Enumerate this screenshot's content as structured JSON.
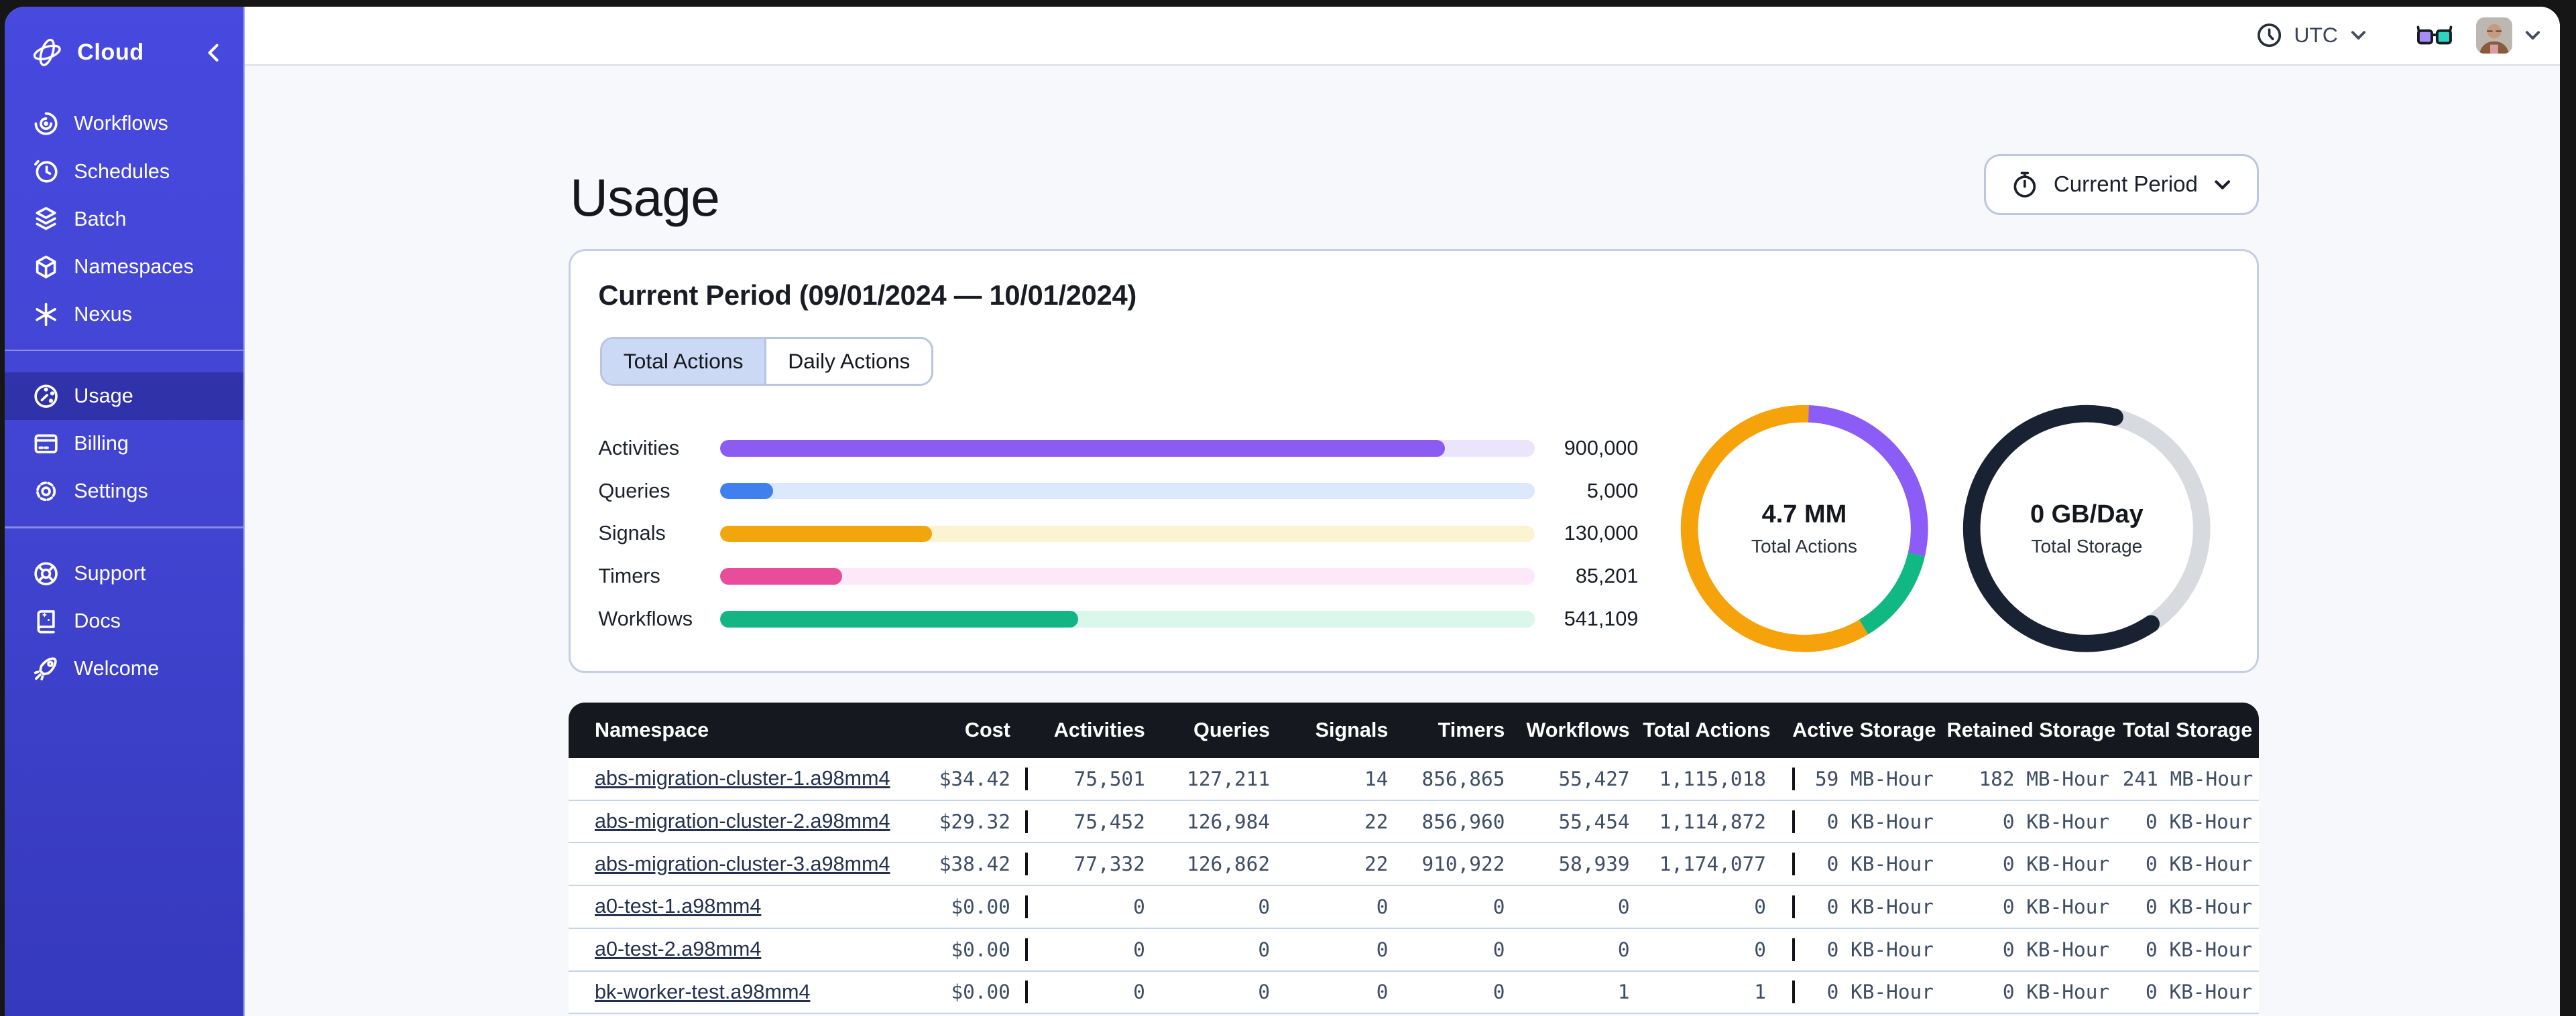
{
  "topbar": {
    "timezone": "UTC"
  },
  "sidebar": {
    "brand": "Cloud",
    "groups": [
      [
        {
          "icon": "workflows-icon",
          "label": "Workflows"
        },
        {
          "icon": "schedules-icon",
          "label": "Schedules"
        },
        {
          "icon": "batch-icon",
          "label": "Batch"
        },
        {
          "icon": "namespaces-icon",
          "label": "Namespaces"
        },
        {
          "icon": "nexus-icon",
          "label": "Nexus"
        }
      ],
      [
        {
          "icon": "usage-icon",
          "label": "Usage",
          "active": true
        },
        {
          "icon": "billing-icon",
          "label": "Billing"
        },
        {
          "icon": "settings-icon",
          "label": "Settings"
        }
      ],
      [
        {
          "icon": "support-icon",
          "label": "Support"
        },
        {
          "icon": "docs-icon",
          "label": "Docs"
        },
        {
          "icon": "welcome-icon",
          "label": "Welcome"
        }
      ]
    ]
  },
  "page": {
    "title": "Usage",
    "period_selector_label": "Current Period"
  },
  "usage_card": {
    "title": "Current Period (09/01/2024 — 10/01/2024)",
    "tabs": [
      {
        "label": "Total Actions",
        "active": true
      },
      {
        "label": "Daily Actions",
        "active": false
      }
    ]
  },
  "colors": {
    "sidebar_indigo": "#4548dc",
    "sidebar_active": "#383cb4",
    "table_header_black": "#15181f",
    "accent_border": "#b7c4e2"
  },
  "chart_data": [
    {
      "type": "bar",
      "orientation": "horizontal",
      "categories": [
        "Activities",
        "Queries",
        "Signals",
        "Timers",
        "Workflows"
      ],
      "values": [
        900000,
        5000,
        130000,
        85201,
        541109
      ],
      "value_labels": [
        "900,000",
        "5,000",
        "130,000",
        "85,201",
        "541,109"
      ],
      "fill_pcts": [
        89,
        6.5,
        26,
        15,
        44
      ],
      "colors": [
        "#8c5cf2",
        "#4080ee",
        "#f2a60d",
        "#e84d9c",
        "#13b585"
      ],
      "track_colors": [
        "#ebe5fb",
        "#dce8fb",
        "#fcf3d1",
        "#fce8f8",
        "#d9f7ea"
      ],
      "title": "",
      "xlabel": "",
      "ylabel": "",
      "grid": false,
      "legend": false
    },
    {
      "type": "donut",
      "name": "total-actions-donut",
      "center_value": "4.7 MM",
      "center_label": "Total Actions",
      "segments": [
        {
          "name": "activities",
          "color": "#8b5cf6",
          "start_deg": 2,
          "sweep_deg": 101
        },
        {
          "name": "workflows",
          "color": "#10b981",
          "start_deg": 103,
          "sweep_deg": 46
        },
        {
          "name": "signals",
          "color": "#f5a20b",
          "start_deg": 149,
          "sweep_deg": 213
        }
      ]
    },
    {
      "type": "donut",
      "name": "total-storage-donut",
      "center_value": "0 GB/Day",
      "center_label": "Total Storage",
      "segments": [
        {
          "name": "remaining",
          "color": "#d7dadf",
          "start_deg": 10,
          "sweep_deg": 136
        },
        {
          "name": "used",
          "color": "#192232",
          "start_deg": 146,
          "sweep_deg": 228,
          "cap": "round"
        }
      ]
    }
  ],
  "table": {
    "columns": [
      {
        "key": "namespace",
        "label": "Namespace"
      },
      {
        "key": "cost",
        "label": "Cost"
      },
      {
        "key": "activities",
        "label": "Activities"
      },
      {
        "key": "queries",
        "label": "Queries"
      },
      {
        "key": "signals",
        "label": "Signals"
      },
      {
        "key": "timers",
        "label": "Timers"
      },
      {
        "key": "workflows",
        "label": "Workflows"
      },
      {
        "key": "total_actions",
        "label": "Total Actions"
      },
      {
        "key": "active_storage",
        "label": "Active Storage"
      },
      {
        "key": "retained_storage",
        "label": "Retained Storage"
      },
      {
        "key": "total_storage",
        "label": "Total Storage"
      }
    ],
    "rows": [
      {
        "namespace": "abs-migration-cluster-1.a98mm4",
        "cost": "$34.42",
        "activities": "75,501",
        "queries": "127,211",
        "signals": "14",
        "timers": "856,865",
        "workflows": "55,427",
        "total_actions": "1,115,018",
        "active_storage": "59 MB-Hour",
        "retained_storage": "182 MB-Hour",
        "total_storage": "241 MB-Hour"
      },
      {
        "namespace": "abs-migration-cluster-2.a98mm4",
        "cost": "$29.32",
        "activities": "75,452",
        "queries": "126,984",
        "signals": "22",
        "timers": "856,960",
        "workflows": "55,454",
        "total_actions": "1,114,872",
        "active_storage": "0 KB-Hour",
        "retained_storage": "0 KB-Hour",
        "total_storage": "0 KB-Hour"
      },
      {
        "namespace": "abs-migration-cluster-3.a98mm4",
        "cost": "$38.42",
        "activities": "77,332",
        "queries": "126,862",
        "signals": "22",
        "timers": "910,922",
        "workflows": "58,939",
        "total_actions": "1,174,077",
        "active_storage": "0 KB-Hour",
        "retained_storage": "0 KB-Hour",
        "total_storage": "0 KB-Hour"
      },
      {
        "namespace": "a0-test-1.a98mm4",
        "cost": "$0.00",
        "activities": "0",
        "queries": "0",
        "signals": "0",
        "timers": "0",
        "workflows": "0",
        "total_actions": "0",
        "active_storage": "0 KB-Hour",
        "retained_storage": "0 KB-Hour",
        "total_storage": "0 KB-Hour"
      },
      {
        "namespace": "a0-test-2.a98mm4",
        "cost": "$0.00",
        "activities": "0",
        "queries": "0",
        "signals": "0",
        "timers": "0",
        "workflows": "0",
        "total_actions": "0",
        "active_storage": "0 KB-Hour",
        "retained_storage": "0 KB-Hour",
        "total_storage": "0 KB-Hour"
      },
      {
        "namespace": "bk-worker-test.a98mm4",
        "cost": "$0.00",
        "activities": "0",
        "queries": "0",
        "signals": "0",
        "timers": "0",
        "workflows": "1",
        "total_actions": "1",
        "active_storage": "0 KB-Hour",
        "retained_storage": "0 KB-Hour",
        "total_storage": "0 KB-Hour"
      }
    ]
  }
}
